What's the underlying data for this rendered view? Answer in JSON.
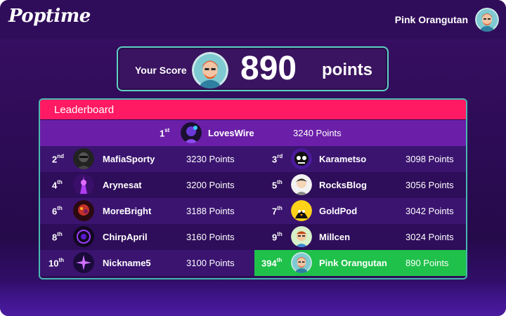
{
  "header": {
    "logo_text": "Poptime",
    "user_name": "Pink Orangutan"
  },
  "score": {
    "label": "Your Score",
    "value": "890",
    "unit": "points"
  },
  "leaderboard": {
    "title": "Leaderboard",
    "first": {
      "rank_num": "1",
      "rank_suffix": "st",
      "name": "LovesWire",
      "points": "3240 Points"
    },
    "left": [
      {
        "rank_num": "2",
        "rank_suffix": "nd",
        "name": "MafiaSporty",
        "points": "3230 Points"
      },
      {
        "rank_num": "4",
        "rank_suffix": "th",
        "name": "Arynesat",
        "points": "3200 Points"
      },
      {
        "rank_num": "6",
        "rank_suffix": "th",
        "name": "MoreBright",
        "points": "3188 Points"
      },
      {
        "rank_num": "8",
        "rank_suffix": "th",
        "name": "ChirpApril",
        "points": "3160 Points"
      },
      {
        "rank_num": "10",
        "rank_suffix": "th",
        "name": "Nickname5",
        "points": "3100 Points"
      }
    ],
    "right": [
      {
        "rank_num": "3",
        "rank_suffix": "rd",
        "name": "Karametso",
        "points": "3098 Points"
      },
      {
        "rank_num": "5",
        "rank_suffix": "th",
        "name": "RocksBlog",
        "points": "3056 Points"
      },
      {
        "rank_num": "7",
        "rank_suffix": "th",
        "name": "GoldPod",
        "points": "3042 Points"
      },
      {
        "rank_num": "9",
        "rank_suffix": "th",
        "name": "Millcen",
        "points": "3024 Points"
      },
      {
        "rank_num": "394",
        "rank_suffix": "th",
        "name": "Pink Orangutan",
        "points": "890 Points"
      }
    ]
  },
  "colors": {
    "background": "#2e0c57",
    "header_accent": "#ff1a63",
    "first_row": "#6b1fa8",
    "current_user_highlight": "#1fc14a",
    "card_border": "#5fd0c2"
  },
  "icons": {
    "user_avatar": "orangutan-avatar-icon",
    "player_avatars": "player-avatar-icon"
  }
}
